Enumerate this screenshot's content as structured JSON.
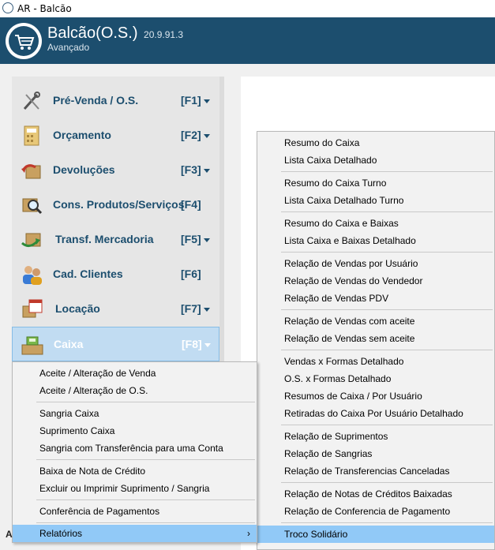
{
  "window": {
    "title": "AR - Balcão"
  },
  "app": {
    "name": "Balcão(O.S.)",
    "version": "20.9.91.3",
    "edition": "Avançado"
  },
  "sidebar": {
    "items": [
      {
        "label": "Pré-Venda / O.S.",
        "key": "[F1]",
        "icon": "tools-icon"
      },
      {
        "label": "Orçamento",
        "key": "[F2]",
        "icon": "calculator-icon"
      },
      {
        "label": "Devoluções",
        "key": "[F3]",
        "icon": "return-box-icon"
      },
      {
        "label": "Cons. Produtos/Serviços",
        "key": "[F4]",
        "icon": "product-search-icon"
      },
      {
        "label": "Transf. Mercadoria",
        "key": "[F5]",
        "icon": "transfer-box-icon"
      },
      {
        "label": "Cad. Clientes",
        "key": "[F6]",
        "icon": "customers-icon"
      },
      {
        "label": "Locação",
        "key": "[F7]",
        "icon": "calendar-box-icon"
      },
      {
        "label": "Caixa",
        "key": "[F8]",
        "icon": "cash-register-icon"
      }
    ]
  },
  "caixa_menu": {
    "items": [
      "Aceite / Alteração de Venda",
      "Aceite / Alteração de O.S.",
      "Sangria Caixa",
      "Suprimento Caixa",
      "Sangria com Transferência para uma Conta",
      "Baixa de Nota de Crédito",
      "Excluir ou Imprimir Suprimento / Sangria",
      "Conferência de Pagamentos",
      "Relatórios"
    ],
    "submenu_arrow": "›"
  },
  "relatorios_menu": {
    "items": [
      "Resumo do Caixa",
      "Lista Caixa Detalhado",
      "Resumo do Caixa Turno",
      "Lista Caixa Detalhado Turno",
      "Resumo do Caixa e Baixas",
      "Lista Caixa e Baixas Detalhado",
      "Relação de Vendas por Usuário",
      "Relação de Vendas do Vendedor",
      "Relação de Vendas PDV",
      "Relação de Vendas com aceite",
      "Relação de Vendas sem aceite",
      "Vendas x Formas Detalhado",
      "O.S. x Formas Detalhado",
      "Resumos de Caixa / Por Usuário",
      "Retiradas do Caixa Por Usuário Detalhado",
      "Relação de Suprimentos",
      "Relação de Sangrias",
      "Relação de Transferencias Canceladas",
      "Relação de Notas de Créditos Baixadas",
      "Relação de Conferencia de Pagamento",
      "Troco Solidário"
    ]
  },
  "footer": {
    "partial_text": "A"
  },
  "colors": {
    "header": "#1c4e6e",
    "highlight": "#91c9f7",
    "active_nav": "#c1dcf2"
  }
}
